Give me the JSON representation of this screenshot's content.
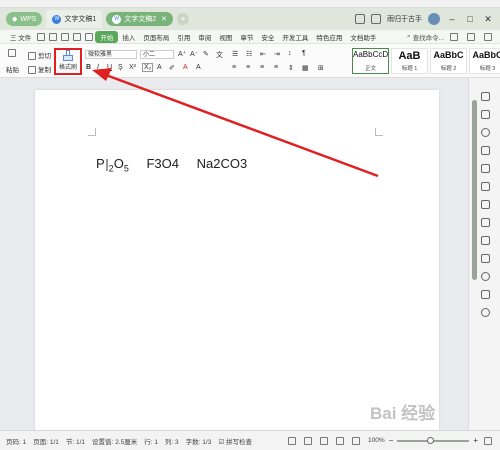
{
  "titlebar": {
    "wps_label": "WPS",
    "tabs": [
      {
        "label": "文字文稿1",
        "active": false
      },
      {
        "label": "文字文稿2",
        "active": true
      }
    ],
    "user_name": "雨归于古手"
  },
  "menubar": {
    "file": "三 文件",
    "items": [
      "开始",
      "插入",
      "页面布局",
      "引用",
      "审阅",
      "视图",
      "章节",
      "安全",
      "开发工具",
      "特色应用",
      "文档助手"
    ],
    "active": "开始",
    "search": "查找命令..."
  },
  "ribbon": {
    "paste": "粘贴",
    "cut": "剪切",
    "copy": "复制",
    "format_painter": "格式刷",
    "font_name": "微软雅黑",
    "font_size": "小二",
    "bold": "B",
    "italic": "I",
    "underline": "U",
    "styles": [
      {
        "sample": "AaBbCcDd",
        "name": "正文"
      },
      {
        "sample": "AaB",
        "name": "标题 1"
      },
      {
        "sample": "AaBbC",
        "name": "标题 2"
      },
      {
        "sample": "AaBbC",
        "name": "标题 3"
      }
    ]
  },
  "document": {
    "formula1_a": "P",
    "formula1_sub1": "2",
    "formula1_b": "O",
    "formula1_sub2": "5",
    "formula2": "F3O4",
    "formula3": "Na2CO3"
  },
  "statusbar": {
    "page_no": "页码: 1",
    "pages": "页面: 1/1",
    "section": "节: 1/1",
    "setting": "设置值: 2.5厘米",
    "row": "行: 1",
    "col": "列: 3",
    "word_count": "字数: 1/3",
    "spell": "拼写检查",
    "zoom": "100%"
  },
  "watermark": "Bai 经验",
  "colors": {
    "accent": "#5aa85a",
    "highlight": "#e02020"
  }
}
